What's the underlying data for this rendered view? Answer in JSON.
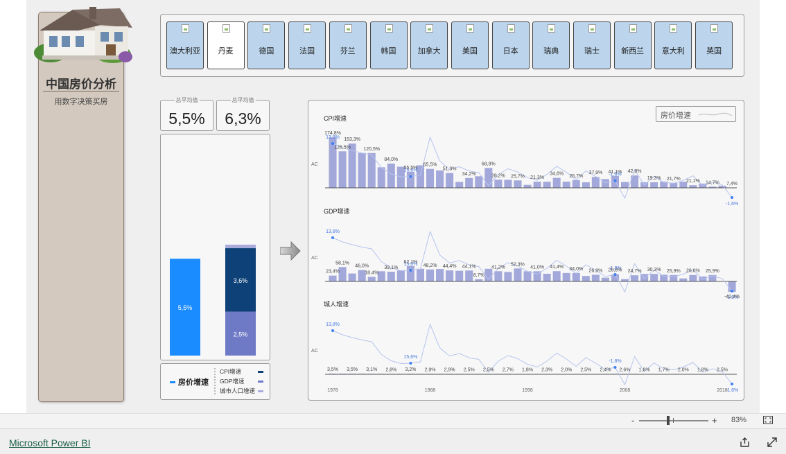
{
  "brand": {
    "title": "中国房价分析",
    "subtitle": "用数字决策买房"
  },
  "countries": [
    {
      "name": "澳大利亚",
      "active": false
    },
    {
      "name": "丹麦",
      "active": true
    },
    {
      "name": "德国",
      "active": false
    },
    {
      "name": "法国",
      "active": false
    },
    {
      "name": "芬兰",
      "active": false
    },
    {
      "name": "韩国",
      "active": false
    },
    {
      "name": "加拿大",
      "active": false
    },
    {
      "name": "美国",
      "active": false
    },
    {
      "name": "日本",
      "active": false
    },
    {
      "name": "瑞典",
      "active": false
    },
    {
      "name": "瑞士",
      "active": false
    },
    {
      "name": "新西兰",
      "active": false
    },
    {
      "name": "意大利",
      "active": false
    },
    {
      "name": "英国",
      "active": false
    }
  ],
  "kpis": [
    {
      "label": "总平均值",
      "value": "5,5%"
    },
    {
      "label": "总平均值",
      "value": "6,3%"
    }
  ],
  "stack_chart": {
    "left_bar": {
      "value": 5.5,
      "label": "5,5%"
    },
    "right_bar": [
      {
        "name": "城市人口增速",
        "value": 0.2,
        "label": ""
      },
      {
        "name": "CPI增速",
        "value": 3.6,
        "label": "3,6%"
      },
      {
        "name": "GDP增速",
        "value": 2.5,
        "label": "2,5%"
      }
    ],
    "max": 6.3
  },
  "stack_legend": {
    "main": "房价增速",
    "items": [
      "CPI增速",
      "GDP增速",
      "城市人口增速"
    ]
  },
  "colors": {
    "house_price": "#1a8cff",
    "cpi": "#0e4177",
    "gdp": "#6f7ac7",
    "urban": "#a9acdb",
    "bars": "#a3a8da",
    "line": "#b7c4ee",
    "point": "#3d7ff0",
    "accent_label": "#4778e0"
  },
  "chart_legend": {
    "label": "房价增速"
  },
  "chart_data": [
    {
      "type": "bar",
      "title": "CPI增速",
      "ylabel": "AC",
      "bar_labels": [
        {
          "i": 0,
          "text": "174,8%"
        },
        {
          "i": 1,
          "text": "126,5%"
        },
        {
          "i": 2,
          "text": "153,3%"
        },
        {
          "i": 4,
          "text": "120,5%"
        },
        {
          "i": 6,
          "text": "84,0%"
        },
        {
          "i": 8,
          "text": "55,5%"
        },
        {
          "i": 10,
          "text": "65,5%"
        },
        {
          "i": 12,
          "text": "51,3%"
        },
        {
          "i": 14,
          "text": "34,2%"
        },
        {
          "i": 16,
          "text": "68,8%"
        },
        {
          "i": 17,
          "text": "28,2%"
        },
        {
          "i": 19,
          "text": "25,7%"
        },
        {
          "i": 21,
          "text": "21,3%"
        },
        {
          "i": 23,
          "text": "34,6%"
        },
        {
          "i": 25,
          "text": "26,7%"
        },
        {
          "i": 27,
          "text": "37,9%"
        },
        {
          "i": 29,
          "text": "41,1%"
        },
        {
          "i": 31,
          "text": "42,8%"
        },
        {
          "i": 33,
          "text": "19,3%"
        },
        {
          "i": 35,
          "text": "21,7%"
        },
        {
          "i": 37,
          "text": "21,1%"
        },
        {
          "i": 39,
          "text": "14,7%"
        },
        {
          "i": 41,
          "text": "7,4%"
        }
      ],
      "point_labels": [
        {
          "i": 0,
          "text": "13,8%"
        },
        {
          "i": 8,
          "text": "15,6%"
        },
        {
          "i": 29,
          "text": "-1,8%"
        },
        {
          "i": 41,
          "text": "-1,6%"
        }
      ]
    },
    {
      "type": "bar",
      "title": "GDP增速",
      "ylabel": "AC",
      "bar_labels": [
        {
          "i": 0,
          "text": "23,4%"
        },
        {
          "i": 1,
          "text": "58,1%"
        },
        {
          "i": 3,
          "text": "46,0%"
        },
        {
          "i": 4,
          "text": "18,4%"
        },
        {
          "i": 6,
          "text": "39,1%"
        },
        {
          "i": 8,
          "text": "62,1%"
        },
        {
          "i": 10,
          "text": "48,2%"
        },
        {
          "i": 12,
          "text": "44,4%"
        },
        {
          "i": 14,
          "text": "44,1%"
        },
        {
          "i": 15,
          "text": "8,7%"
        },
        {
          "i": 17,
          "text": "41,2%"
        },
        {
          "i": 19,
          "text": "52,3%"
        },
        {
          "i": 21,
          "text": "41,0%"
        },
        {
          "i": 23,
          "text": "41,4%"
        },
        {
          "i": 25,
          "text": "34,0%"
        },
        {
          "i": 27,
          "text": "26,9%"
        },
        {
          "i": 29,
          "text": "28,8%"
        },
        {
          "i": 31,
          "text": "24,7%"
        },
        {
          "i": 33,
          "text": "30,3%"
        },
        {
          "i": 35,
          "text": "25,9%"
        },
        {
          "i": 37,
          "text": "26,0%"
        },
        {
          "i": 39,
          "text": "25,9%"
        },
        {
          "i": 41,
          "text": "-42,4%"
        }
      ],
      "point_labels": [
        {
          "i": 0,
          "text": "13,8%"
        },
        {
          "i": 8,
          "text": "15,6%"
        },
        {
          "i": 29,
          "text": "-1,8%"
        },
        {
          "i": 41,
          "text": "-1,6%"
        }
      ]
    },
    {
      "type": "bar",
      "title": "城人增速",
      "ylabel": "AC",
      "bar_labels": [
        {
          "i": 0,
          "text": "3,5%"
        },
        {
          "i": 2,
          "text": "3,5%"
        },
        {
          "i": 4,
          "text": "3,1%"
        },
        {
          "i": 6,
          "text": "2,8%"
        },
        {
          "i": 8,
          "text": "3,2%"
        },
        {
          "i": 10,
          "text": "2,9%"
        },
        {
          "i": 12,
          "text": "2,9%"
        },
        {
          "i": 14,
          "text": "2,5%"
        },
        {
          "i": 16,
          "text": "2,5%"
        },
        {
          "i": 18,
          "text": "2,7%"
        },
        {
          "i": 20,
          "text": "1,8%"
        },
        {
          "i": 22,
          "text": "2,3%"
        },
        {
          "i": 24,
          "text": "2,0%"
        },
        {
          "i": 26,
          "text": "2,5%"
        },
        {
          "i": 28,
          "text": "2,4%"
        },
        {
          "i": 30,
          "text": "2,6%"
        },
        {
          "i": 32,
          "text": "1,8%"
        },
        {
          "i": 34,
          "text": "1,7%"
        },
        {
          "i": 36,
          "text": "2,0%"
        },
        {
          "i": 38,
          "text": "1,8%"
        },
        {
          "i": 40,
          "text": "2,5%"
        }
      ],
      "point_labels": [
        {
          "i": 0,
          "text": "13,8%"
        },
        {
          "i": 8,
          "text": "15,6%"
        },
        {
          "i": 29,
          "text": "-1,8%"
        },
        {
          "i": 41,
          "text": "-1,6%"
        }
      ],
      "x_ticks": [
        {
          "i": 0,
          "text": "1978"
        },
        {
          "i": 10,
          "text": "1988"
        },
        {
          "i": 20,
          "text": "1998"
        },
        {
          "i": 30,
          "text": "2008"
        },
        {
          "i": 40,
          "text": "2018"
        }
      ]
    }
  ],
  "series_values": {
    "years": [
      1978,
      1979,
      1980,
      1981,
      1982,
      1983,
      1984,
      1985,
      1986,
      1987,
      1988,
      1989,
      1990,
      1991,
      1992,
      1993,
      1994,
      1995,
      1996,
      1997,
      1998,
      1999,
      2000,
      2001,
      2002,
      2003,
      2004,
      2005,
      2006,
      2007,
      2008,
      2009,
      2010,
      2011,
      2012,
      2013,
      2014,
      2015,
      2016,
      2017,
      2018,
      2019
    ],
    "house_price": [
      13.8,
      12.6,
      11.8,
      11.1,
      10.6,
      6.9,
      5.1,
      4.3,
      4.4,
      4.8,
      15.6,
      8.8,
      6.5,
      7.2,
      6.0,
      5.5,
      1.8,
      5.0,
      6.6,
      5.7,
      4.1,
      3.3,
      5.0,
      7.3,
      5.6,
      3.5,
      6.0,
      4.4,
      2.6,
      3.2,
      -1.8,
      6.3,
      2.0,
      4.5,
      2.7,
      2.5,
      3.3,
      4.6,
      1.8,
      2.8,
      2.0,
      -1.6
    ],
    "cpi": [
      174.8,
      126.5,
      153.3,
      120.5,
      120.5,
      71.2,
      84.0,
      73.1,
      55.5,
      78.0,
      65.5,
      60.2,
      51.3,
      20.5,
      34.2,
      40.1,
      68.8,
      28.2,
      27.8,
      25.7,
      10.3,
      21.3,
      21.0,
      34.6,
      21.4,
      26.7,
      19.2,
      37.9,
      30.2,
      41.1,
      20.3,
      42.8,
      19.3,
      19.3,
      21.7,
      17.1,
      21.1,
      9.1,
      14.7,
      4.2,
      7.4,
      0
    ],
    "gdp": [
      23.4,
      58.1,
      32.0,
      46.0,
      18.4,
      41.0,
      39.1,
      44.0,
      62.1,
      51.0,
      48.2,
      50.1,
      44.4,
      43.0,
      44.1,
      8.7,
      51.0,
      41.2,
      38.0,
      52.3,
      41.0,
      41.0,
      31.0,
      41.4,
      34.0,
      34.0,
      22.0,
      26.9,
      15.0,
      28.8,
      9.0,
      24.7,
      30.0,
      30.3,
      27.0,
      25.9,
      12.0,
      26.0,
      20.0,
      25.9,
      0,
      -42.4
    ],
    "urban": [
      3.5,
      3.4,
      3.5,
      3.2,
      3.1,
      3.0,
      2.8,
      2.9,
      3.2,
      3.0,
      2.9,
      2.8,
      2.9,
      2.7,
      2.5,
      2.6,
      2.5,
      2.6,
      2.7,
      2.3,
      1.8,
      2.2,
      2.3,
      2.1,
      2.0,
      2.2,
      2.5,
      2.3,
      2.4,
      2.5,
      2.6,
      2.2,
      1.8,
      1.9,
      1.7,
      1.8,
      2.0,
      1.9,
      1.8,
      2.0,
      2.5,
      1.9
    ]
  },
  "status_bar": {
    "zoom_minus": "-",
    "zoom_plus": "+",
    "zoom_level": "83%",
    "zoom_fraction": 0.42
  },
  "footer": {
    "link": "Microsoft Power BI"
  },
  "icons": {
    "house": "house-illustration",
    "arrow": "arrow-right-icon",
    "share": "share-icon",
    "fullscreen": "expand-icon",
    "fit": "fit-to-page-icon"
  }
}
